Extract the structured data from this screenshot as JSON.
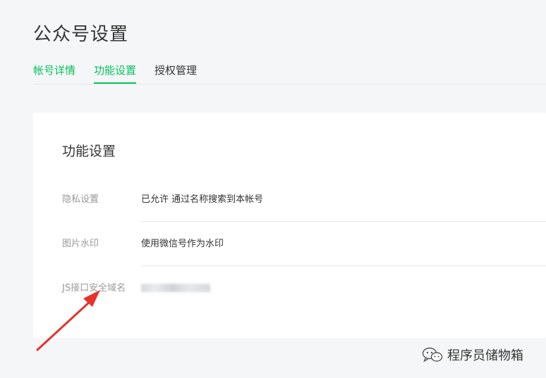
{
  "page": {
    "title": "公众号设置"
  },
  "tabs": [
    {
      "label": "帐号详情"
    },
    {
      "label": "功能设置"
    },
    {
      "label": "授权管理"
    }
  ],
  "card": {
    "title": "功能设置",
    "rows": [
      {
        "label": "隐私设置",
        "value": "已允许 通过名称搜索到本帐号"
      },
      {
        "label": "图片水印",
        "value": "使用微信号作为水印"
      },
      {
        "label": "JS接口安全域名",
        "value": ""
      }
    ]
  },
  "watermark": {
    "text": "程序员储物箱",
    "icon": "wechat-icon"
  },
  "annotation": {
    "icon": "red-arrow-icon",
    "color": "#e8322a"
  },
  "colors": {
    "accent": "#07c160",
    "text": "#353535",
    "muted": "#9a9a9a",
    "background": "#f5f6f7"
  }
}
